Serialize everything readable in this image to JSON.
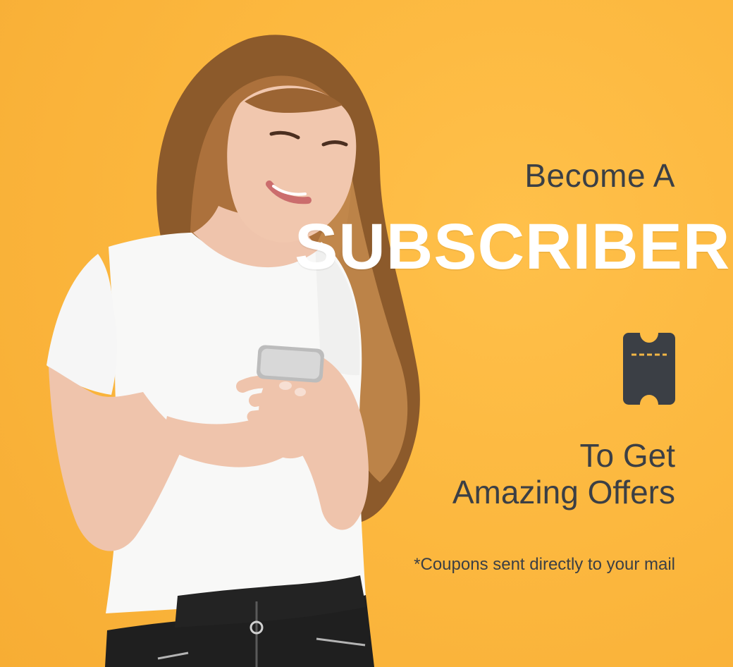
{
  "banner": {
    "colors": {
      "background": "#fcb83f",
      "primary_text": "#3b3f45",
      "highlight_text": "#ffffff",
      "icon": "#3b3f45"
    },
    "headline_top": "Become A",
    "headline_main": "SUBSCRIBER",
    "icon": "ticket-icon",
    "offer_line_1": "To Get",
    "offer_line_2": "Amazing Offers",
    "footnote": "*Coupons sent directly to your mail"
  }
}
